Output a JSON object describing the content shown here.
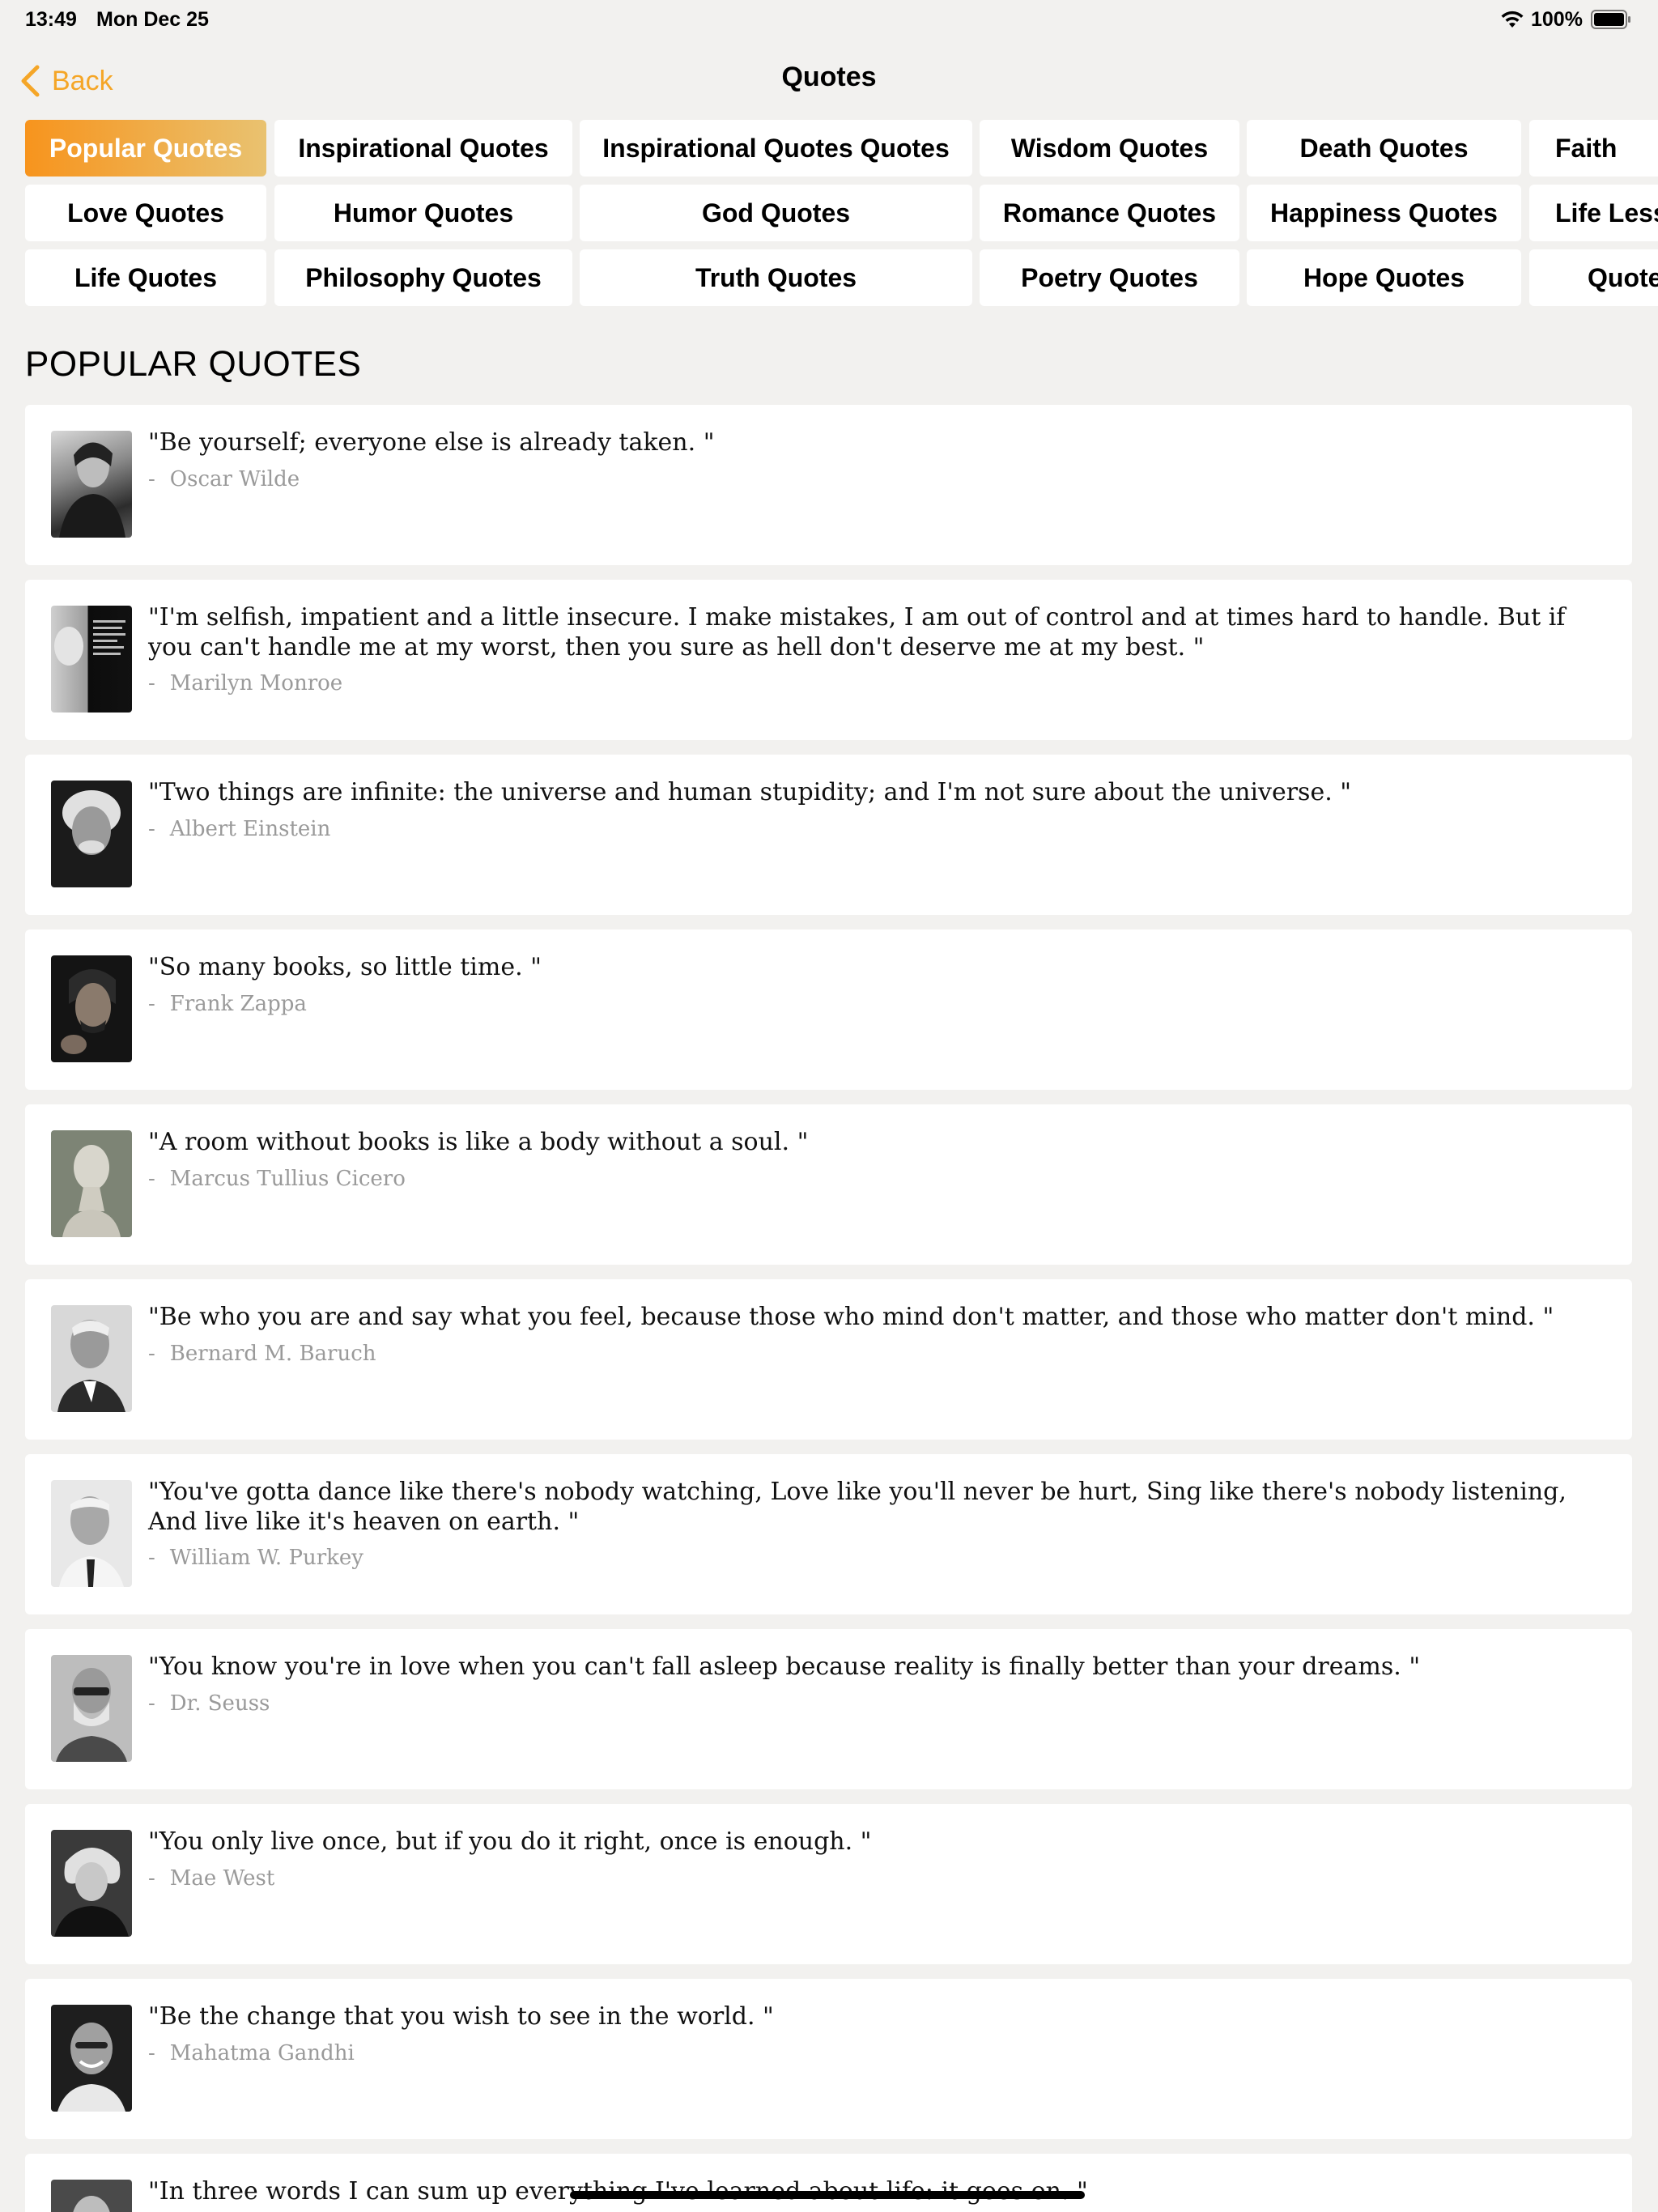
{
  "status_bar": {
    "time": "13:49",
    "date": "Mon Dec 25",
    "battery": "100%"
  },
  "nav": {
    "back_label": "Back",
    "title": "Quotes"
  },
  "colors": {
    "accent": "#f5a627",
    "active_tab_start": "#f7941d",
    "active_tab_end": "#e9c270",
    "background": "#f2f1ef",
    "author_text": "#9a9a9a"
  },
  "tabs": [
    [
      "Popular Quotes",
      "Inspirational Quotes",
      "Inspirational Quotes Quotes",
      "Wisdom Quotes",
      "Death Quotes",
      "Faith"
    ],
    [
      "Love Quotes",
      "Humor Quotes",
      "God Quotes",
      "Romance Quotes",
      "Happiness Quotes",
      "Life Less"
    ],
    [
      "Life Quotes",
      "Philosophy Quotes",
      "Truth Quotes",
      "Poetry Quotes",
      "Hope Quotes",
      "Quote"
    ]
  ],
  "active_tab": "Popular Quotes",
  "section_title": "POPULAR QUOTES",
  "quotes": [
    {
      "text": "\"Be yourself; everyone else is already taken. \"",
      "author": "Oscar Wilde"
    },
    {
      "text": "\"I'm selfish, impatient and a little insecure. I make mistakes, I am out of control and at times hard to handle. But if you can't handle me at my worst, then you sure as hell don't deserve me at my best. \"",
      "author": "Marilyn Monroe"
    },
    {
      "text": "\"Two things are infinite: the universe and human stupidity; and I'm not sure about the universe. \"",
      "author": "Albert Einstein"
    },
    {
      "text": "\"So many books, so little time. \"",
      "author": "Frank Zappa"
    },
    {
      "text": "\"A room without books is like a body without a soul. \"",
      "author": "Marcus Tullius Cicero"
    },
    {
      "text": "\"Be who you are and say what you feel, because those who mind don't matter, and those who matter don't mind. \"",
      "author": "Bernard M. Baruch"
    },
    {
      "text": "\"You've gotta dance like there's nobody watching, Love like you'll never be hurt, Sing like there's nobody listening, And live like it's heaven on earth. \"",
      "author": "William W. Purkey"
    },
    {
      "text": "\"You know you're in love when you can't fall asleep because reality is finally better than your dreams. \"",
      "author": "Dr. Seuss"
    },
    {
      "text": "\"You only live once, but if you do it right, once is enough. \"",
      "author": "Mae West"
    },
    {
      "text": "\"Be the change that you wish to see in the world. \"",
      "author": "Mahatma Gandhi"
    },
    {
      "text": "\"In three words I can sum up everything I've learned about life: it goes on. \"",
      "author": ""
    }
  ],
  "author_prefix": "-"
}
